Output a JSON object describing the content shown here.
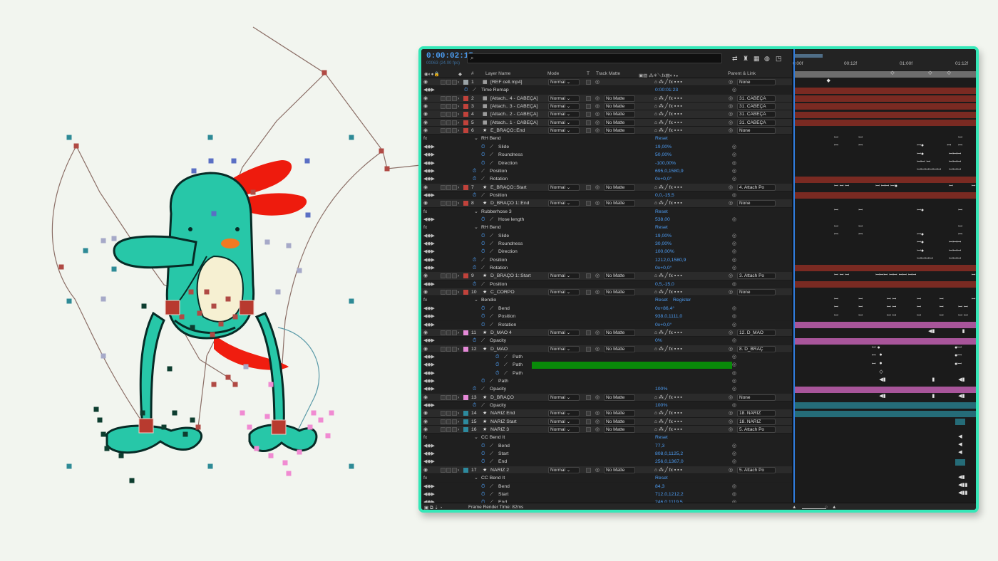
{
  "comp": {
    "timecode": "0:00:02:15",
    "fps": "00063 (24.00 fps)",
    "search_placeholder": "⌕",
    "render_time": "Frame Render Time: 82ms"
  },
  "headers": {
    "num": "#",
    "layer_name": "Layer Name",
    "mode": "Mode",
    "t": "T",
    "track_matte": "Track Matte",
    "parent": "Parent & Link"
  },
  "timeline": {
    "ticks": [
      "0:00f",
      "00:12f",
      "01:00f",
      "01:12f"
    ]
  },
  "colors": {
    "accent_frame": "#35e8b8",
    "timecode": "#4b9bef",
    "label_red": "#c0423b",
    "label_pink": "#e589d7",
    "label_teal": "#2d8a9e",
    "label_gray": "#9aa3a6",
    "bar_red": "#7a2a22",
    "bar_pink": "#a8559a",
    "bar_teal": "#256c78",
    "bar_gray": "#6d6d6d",
    "path_green": "#098a09"
  },
  "rows": [
    {
      "kind": "layer",
      "num": "1",
      "label": "gray",
      "name": "[REF cell.mp4]",
      "mode": "Normal",
      "matte": "",
      "parent": "None",
      "bar": "gray",
      "keys": [
        {
          "p": 0.52,
          "s": "◇"
        },
        {
          "p": 0.72,
          "s": "◇"
        },
        {
          "p": 0.82,
          "s": "◇"
        }
      ]
    },
    {
      "kind": "prop",
      "indent": 1,
      "name": "Time Remap",
      "value": "0:00:01:23",
      "keys": [
        {
          "p": 0.18,
          "s": "◆"
        }
      ]
    },
    {
      "kind": "layer",
      "num": "2",
      "label": "red",
      "name": "[Attach.. 4 - CABEÇA]",
      "mode": "Normal",
      "matte": "No Matte",
      "parent": "31. CABEÇA",
      "bar": "red",
      "keys": []
    },
    {
      "kind": "layer",
      "num": "3",
      "label": "red",
      "name": "[Attach.. 3 - CABEÇA]",
      "mode": "Normal",
      "matte": "No Matte",
      "parent": "31. CABEÇA",
      "bar": "red",
      "keys": []
    },
    {
      "kind": "layer",
      "num": "4",
      "label": "red",
      "name": "[Attach.. 2 - CABEÇA]",
      "mode": "Normal",
      "matte": "No Matte",
      "parent": "31. CABEÇA",
      "bar": "red",
      "keys": []
    },
    {
      "kind": "layer",
      "num": "5",
      "label": "red",
      "name": "[Attach.. 1 - CABEÇA]",
      "mode": "Normal",
      "matte": "No Matte",
      "parent": "31. CABEÇA",
      "bar": "red",
      "keys": []
    },
    {
      "kind": "layer",
      "num": "6",
      "label": "red",
      "name": "E_BRAÇO::End",
      "mode": "Normal",
      "matte": "No Matte",
      "parent": "None",
      "bar": "red",
      "keys": []
    },
    {
      "kind": "group",
      "indent": 2,
      "name": "RH Bend",
      "value": "Reset"
    },
    {
      "kind": "prop",
      "indent": 3,
      "name": "Slide",
      "value": "19,00%",
      "keys": [
        {
          "p": 0.22,
          "s": "ꟷ"
        },
        {
          "p": 0.35,
          "s": "ꟷ"
        },
        {
          "p": 0.88,
          "s": "ꟷ"
        }
      ]
    },
    {
      "kind": "prop",
      "indent": 3,
      "name": "Roundness",
      "value": "50,00%",
      "keys": [
        {
          "p": 0.22,
          "s": "ꟷ"
        },
        {
          "p": 0.35,
          "s": "ꟷ"
        },
        {
          "p": 0.66,
          "s": "ꟷ●"
        },
        {
          "p": 0.82,
          "s": "ꟷ"
        },
        {
          "p": 0.88,
          "s": "ꟷ"
        }
      ]
    },
    {
      "kind": "prop",
      "indent": 3,
      "name": "Direction",
      "value": "-100,00%",
      "keys": [
        {
          "p": 0.66,
          "s": "ꟷ●"
        },
        {
          "p": 0.83,
          "s": "ꟷꟷꟷ"
        }
      ]
    },
    {
      "kind": "prop",
      "indent": 2,
      "name": "Position",
      "value": "695,0,1580,9",
      "keys": [
        {
          "p": 0.66,
          "s": "ꟷꟷ ꟷ"
        },
        {
          "p": 0.83,
          "s": "ꟷꟷꟷ"
        }
      ]
    },
    {
      "kind": "prop",
      "indent": 2,
      "name": "Rotation",
      "value": "0x+0,0°",
      "keys": [
        {
          "p": 0.66,
          "s": "ꟷꟷꟷꟷꟷꟷ"
        },
        {
          "p": 0.83,
          "s": "ꟷꟷꟷ"
        }
      ]
    },
    {
      "kind": "layer",
      "num": "7",
      "label": "red",
      "name": "E_BRAÇO::Start",
      "mode": "Normal",
      "matte": "No Matte",
      "parent": "4. Attach Po",
      "bar": "red",
      "keys": []
    },
    {
      "kind": "prop",
      "indent": 2,
      "name": "Position",
      "value": "0,0,-15,5",
      "keys": [
        {
          "p": 0.22,
          "s": "ꟷ ꟷ ꟷ"
        },
        {
          "p": 0.44,
          "s": "ꟷ  ꟷꟷ  ꟷ●"
        },
        {
          "p": 0.83,
          "s": "ꟷ"
        },
        {
          "p": 0.95,
          "s": "ꟷ"
        }
      ]
    },
    {
      "kind": "layer",
      "num": "8",
      "label": "red",
      "name": "D_BRAÇO 1::End",
      "mode": "Normal",
      "matte": "No Matte",
      "parent": "None",
      "bar": "red",
      "keys": []
    },
    {
      "kind": "group",
      "indent": 2,
      "name": "Rubberhose 3",
      "value": "Reset"
    },
    {
      "kind": "prop",
      "indent": 3,
      "name": "Hose length",
      "value": "538,00",
      "keys": [
        {
          "p": 0.22,
          "s": "ꟷ"
        },
        {
          "p": 0.35,
          "s": "ꟷ"
        },
        {
          "p": 0.66,
          "s": "ꟷ●"
        },
        {
          "p": 0.88,
          "s": "ꟷ"
        }
      ]
    },
    {
      "kind": "group",
      "indent": 2,
      "name": "RH Bend",
      "value": "Reset"
    },
    {
      "kind": "prop",
      "indent": 3,
      "name": "Slide",
      "value": "19,00%",
      "keys": [
        {
          "p": 0.22,
          "s": "ꟷ"
        },
        {
          "p": 0.35,
          "s": "ꟷ"
        },
        {
          "p": 0.88,
          "s": "ꟷ"
        }
      ]
    },
    {
      "kind": "prop",
      "indent": 3,
      "name": "Roundness",
      "value": "30,00%",
      "keys": [
        {
          "p": 0.22,
          "s": "ꟷ"
        },
        {
          "p": 0.35,
          "s": "ꟷ"
        },
        {
          "p": 0.66,
          "s": "ꟷ●"
        },
        {
          "p": 0.88,
          "s": "ꟷ"
        }
      ]
    },
    {
      "kind": "prop",
      "indent": 3,
      "name": "Direction",
      "value": "100,00%",
      "keys": [
        {
          "p": 0.66,
          "s": "ꟷ●"
        },
        {
          "p": 0.83,
          "s": "ꟷꟷꟷ"
        }
      ]
    },
    {
      "kind": "prop",
      "indent": 2,
      "name": "Position",
      "value": "1212,0,1580,9",
      "keys": [
        {
          "p": 0.66,
          "s": "ꟷ●"
        },
        {
          "p": 0.83,
          "s": "ꟷꟷꟷ"
        }
      ]
    },
    {
      "kind": "prop",
      "indent": 2,
      "name": "Rotation",
      "value": "0x+0,0°",
      "keys": [
        {
          "p": 0.66,
          "s": "ꟷꟷꟷꟷ"
        },
        {
          "p": 0.83,
          "s": "ꟷꟷꟷ"
        }
      ]
    },
    {
      "kind": "layer",
      "num": "9",
      "label": "red",
      "name": "D_BRAÇO 1::Start",
      "mode": "Normal",
      "matte": "No Matte",
      "parent": "3. Attach Po",
      "bar": "red",
      "keys": []
    },
    {
      "kind": "prop",
      "indent": 2,
      "name": "Position",
      "value": "0,5,-15,0",
      "keys": [
        {
          "p": 0.22,
          "s": "ꟷ ꟷ ꟷ"
        },
        {
          "p": 0.44,
          "s": "ꟷꟷꟷ  ꟷꟷ  ꟷꟷ  ꟷꟷ"
        },
        {
          "p": 0.95,
          "s": "ꟷ"
        }
      ]
    },
    {
      "kind": "layer",
      "num": "10",
      "label": "red",
      "name": "C_CORPO",
      "mode": "Normal",
      "matte": "No Matte",
      "parent": "None",
      "bar": "red",
      "keys": []
    },
    {
      "kind": "group",
      "indent": 2,
      "name": "Bendio",
      "value": "Reset",
      "value2": "Register"
    },
    {
      "kind": "prop",
      "indent": 3,
      "name": "Bend",
      "value": "0x+86,4°",
      "keys": [
        {
          "p": 0.22,
          "s": "ꟷ"
        },
        {
          "p": 0.35,
          "s": "ꟷ"
        },
        {
          "p": 0.5,
          "s": "ꟷ ꟷ"
        },
        {
          "p": 0.66,
          "s": "ꟷ"
        },
        {
          "p": 0.78,
          "s": "ꟷ"
        },
        {
          "p": 0.95,
          "s": "ꟷ"
        }
      ]
    },
    {
      "kind": "prop",
      "indent": 3,
      "name": "Position",
      "value": "938,0,1111,0",
      "keys": [
        {
          "p": 0.22,
          "s": "ꟷ"
        },
        {
          "p": 0.35,
          "s": "ꟷ"
        },
        {
          "p": 0.5,
          "s": "ꟷ ꟷ"
        },
        {
          "p": 0.66,
          "s": "ꟷ"
        },
        {
          "p": 0.78,
          "s": "ꟷ"
        },
        {
          "p": 0.88,
          "s": "ꟷ ꟷ"
        }
      ]
    },
    {
      "kind": "prop",
      "indent": 3,
      "name": "Rotation",
      "value": "0x+0,0°",
      "keys": [
        {
          "p": 0.22,
          "s": "ꟷ"
        },
        {
          "p": 0.35,
          "s": "ꟷ"
        },
        {
          "p": 0.5,
          "s": "ꟷ ꟷ"
        },
        {
          "p": 0.66,
          "s": "ꟷ"
        },
        {
          "p": 0.78,
          "s": "ꟷ"
        },
        {
          "p": 0.88,
          "s": "ꟷ ꟷ"
        }
      ]
    },
    {
      "kind": "layer",
      "num": "11",
      "label": "pink",
      "name": "D_MAO 4",
      "mode": "Normal",
      "matte": "No Matte",
      "parent": "12. D_MAO",
      "bar": "pink",
      "keys": []
    },
    {
      "kind": "prop",
      "indent": 2,
      "name": "Opacity",
      "value": "0%",
      "keys": [
        {
          "p": 0.72,
          "s": "◀▮"
        },
        {
          "p": 0.9,
          "s": "▮"
        }
      ]
    },
    {
      "kind": "layer",
      "num": "12",
      "label": "pink",
      "name": "D_MAO",
      "mode": "Normal",
      "matte": "No Matte",
      "parent": "8. D_BRAÇ",
      "bar": "pink",
      "keys": []
    },
    {
      "kind": "prop",
      "indent": 4,
      "name": "Path",
      "value": "",
      "keys": [
        {
          "p": 0.42,
          "s": "ꟷ ●"
        },
        {
          "p": 0.86,
          "s": "●ꟷ"
        }
      ]
    },
    {
      "kind": "prop",
      "indent": 4,
      "name": "Path",
      "value": "",
      "green": true,
      "keys": [
        {
          "p": 0.42,
          "s": "ꟷ"
        },
        {
          "p": 0.46,
          "s": "●"
        },
        {
          "p": 0.86,
          "s": "●ꟷ"
        }
      ]
    },
    {
      "kind": "prop",
      "indent": 4,
      "name": "Path",
      "value": "",
      "keys": [
        {
          "p": 0.42,
          "s": "ꟷ"
        },
        {
          "p": 0.46,
          "s": "●"
        },
        {
          "p": 0.86,
          "s": "●ꟷ"
        }
      ]
    },
    {
      "kind": "prop",
      "indent": 3,
      "name": "Path",
      "value": "",
      "keys": [
        {
          "p": 0.46,
          "s": "◇"
        }
      ]
    },
    {
      "kind": "prop",
      "indent": 2,
      "name": "Opacity",
      "value": "100%",
      "keys": [
        {
          "p": 0.46,
          "s": "◀▮"
        },
        {
          "p": 0.74,
          "s": "▮"
        },
        {
          "p": 0.88,
          "s": "◀▮"
        }
      ]
    },
    {
      "kind": "layer",
      "num": "13",
      "label": "pink",
      "name": "D_BRAÇO",
      "mode": "Normal",
      "matte": "No Matte",
      "parent": "None",
      "bar": "pink",
      "keys": []
    },
    {
      "kind": "prop",
      "indent": 2,
      "name": "Opacity",
      "value": "100%",
      "keys": [
        {
          "p": 0.46,
          "s": "◀▮"
        },
        {
          "p": 0.74,
          "s": "▮"
        },
        {
          "p": 0.88,
          "s": "◀▮"
        }
      ]
    },
    {
      "kind": "layer",
      "num": "14",
      "label": "teal",
      "name": "NARIZ End",
      "mode": "Normal",
      "matte": "No Matte",
      "parent": "18. NARIZ",
      "bar": "teal",
      "keys": []
    },
    {
      "kind": "layer",
      "num": "15",
      "label": "teal",
      "name": "NARIZ Start",
      "mode": "Normal",
      "matte": "No Matte",
      "parent": "18. NARIZ",
      "bar": "teal",
      "keys": []
    },
    {
      "kind": "layer",
      "num": "16",
      "label": "teal",
      "name": "NARIZ 3",
      "mode": "Normal",
      "matte": "No Matte",
      "parent": "5. Attach Po",
      "bar": "teal-end",
      "keys": []
    },
    {
      "kind": "group",
      "indent": 2,
      "name": "CC Bend It",
      "value": "Reset"
    },
    {
      "kind": "prop",
      "indent": 3,
      "name": "Bend",
      "value": "77,3",
      "keys": [
        {
          "p": 0.88,
          "s": "◀"
        }
      ]
    },
    {
      "kind": "prop",
      "indent": 3,
      "name": "Start",
      "value": "808,0,1125,2",
      "keys": [
        {
          "p": 0.88,
          "s": "◀"
        }
      ]
    },
    {
      "kind": "prop",
      "indent": 3,
      "name": "End",
      "value": "256,0,1367,0",
      "keys": [
        {
          "p": 0.88,
          "s": "◀"
        }
      ]
    },
    {
      "kind": "layer",
      "num": "17",
      "label": "teal",
      "name": "NARIZ 2",
      "mode": "Normal",
      "matte": "No Matte",
      "parent": "5. Attach Po",
      "bar": "teal-end",
      "keys": []
    },
    {
      "kind": "group",
      "indent": 2,
      "name": "CC Bend It",
      "value": "Reset"
    },
    {
      "kind": "prop",
      "indent": 3,
      "name": "Bend",
      "value": "84,3",
      "keys": [
        {
          "p": 0.88,
          "s": "◀▮"
        }
      ]
    },
    {
      "kind": "prop",
      "indent": 3,
      "name": "Start",
      "value": "712,0,1212,2",
      "keys": [
        {
          "p": 0.88,
          "s": "◀▮▮"
        }
      ]
    },
    {
      "kind": "prop",
      "indent": 3,
      "name": "End",
      "value": "246,0,1119,5",
      "keys": [
        {
          "p": 0.88,
          "s": "◀▮▮"
        }
      ]
    }
  ]
}
